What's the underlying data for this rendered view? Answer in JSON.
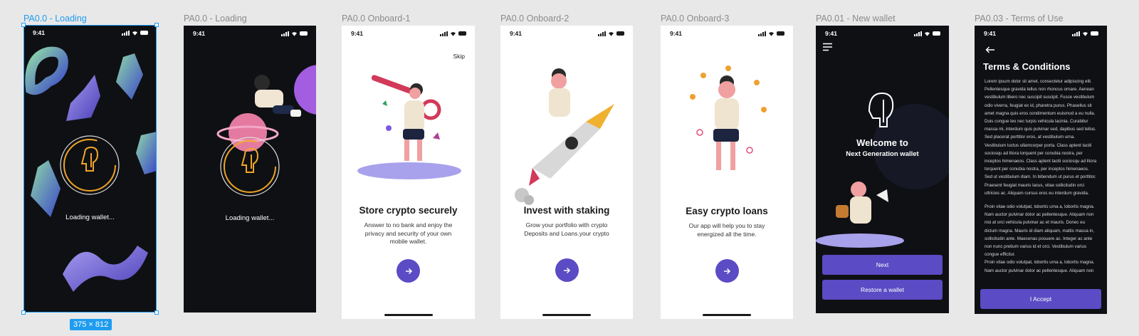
{
  "frames": [
    {
      "label": "PA0.0 - Loading",
      "time": "9:41",
      "text": "Loading wallet..."
    },
    {
      "label": "PA0.0 - Loading",
      "time": "9:41",
      "text": "Loading wallet..."
    },
    {
      "label": "PA0.0 Onboard-1",
      "time": "9:41",
      "skip": "Skip",
      "title": "Store crypto securely",
      "body": "Answer to no bank and enjoy the privacy and security of your own mobile wallet."
    },
    {
      "label": "PA0.0 Onboard-2",
      "time": "9:41",
      "title": "Invest with staking",
      "body": "Grow your portfolio with crypto Deposits and Loans.your crypto"
    },
    {
      "label": "PA0.0 Onboard-3",
      "time": "9:41",
      "title": "Easy crypto loans",
      "body": "Our app will help you to stay energized all the time."
    },
    {
      "label": "PA0.01 - New wallet",
      "time": "9:41",
      "welcome": "Welcome to",
      "subtitle": "Next Generation wallet",
      "next": "Next",
      "restore": "Restore a wallet"
    },
    {
      "label": "PA0.03 - Terms of Use",
      "time": "9:41",
      "title": "Terms & Conditions",
      "accept": "I Accept",
      "para1": "Lorem ipsum dolor sit amet, consectetur adipiscing elit. Pellentesque gravida tellus non rhoncus ornare. Aenean vestibulum libero nec suscipit suscipit. Fusce vestibulum odio viverra, feugiat ex id, pharetra purus. Phasellus sit amet magna quis eros condimentum euismod a eu nulla. Duis congue leo nec turpis vehicula lacinia. Curabitur massa mi, interdum quis pulvinar sed, dapibus sed tellus. Sed placerat porttitor eros, at vestibulum urna. Vestibulum luctus ullamcorper porta. Class aptent taciti sociosqu ad litora torquent per conubia nostra, per inceptos himenaeos. Class aptent taciti sociosqu ad litora torquent per conubia nostra, per inceptos himenaeos. Sed ut vestibulum diam. In bibendum ut purus et porttitor. Praesent feugiat mauris lacus, vitae sollicitudin orci ultricies ac. Aliquam cursus eros eu interdum gravida.",
      "para2": "Proin vitae odio volutpat, lobortis urna a, lobortis magna. Nam auctor pulvinar dolor ac pellentesque. Aliquam non nisi at orci vehicula pulvinar ac et mauris. Donec eu dictum magna. Mauris id diam aliquam, mattis massa in, sollicitudin ante. Maecenas posuere ac. Integer ac ante non nunc pretium varius id et orci. Vestibulum varius congue efficitur.",
      "para3": "Proin vitae odio volutpat, lobortis urna a, lobortis magna. Nam auctor pulvinar dolor ac pellentesque. Aliquam non"
    }
  ],
  "selection_size": "375 × 812",
  "colors": {
    "accent": "#5b4bc4",
    "selection": "#1f9cf0",
    "dark_bg": "#0f1014",
    "logo": "#f0a526"
  }
}
